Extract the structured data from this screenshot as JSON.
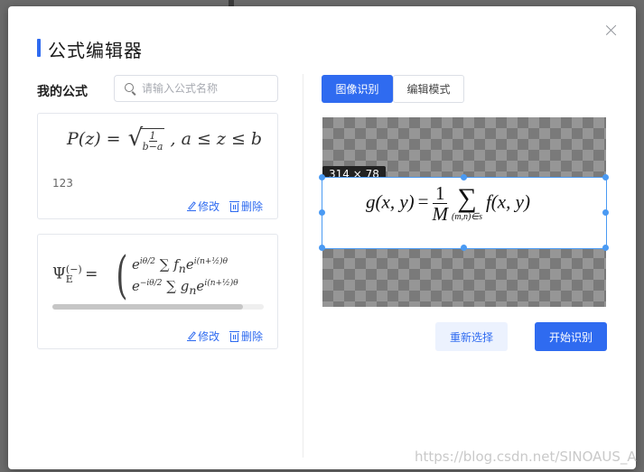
{
  "dialog": {
    "title": "公式编辑器",
    "watermark": "https://blog.csdn.net/SINOAUS_A"
  },
  "left": {
    "section_label": "我的公式",
    "search_placeholder": "请输入公式名称",
    "cards": [
      {
        "formula": {
          "lhs": "P(z) =",
          "frac_num": "1",
          "frac_den": "b−a",
          "rhs": ", a ≤ z ≤ b"
        },
        "note": "123",
        "edit_label": "修改",
        "delete_label": "删除"
      },
      {
        "formula": {
          "lhs_base": "Ψ",
          "lhs_sup": "(−)",
          "lhs_sub": "E",
          "eq": "=",
          "row1": "e",
          "row1_sup": "iθ/2",
          "row1_rest": " ∑ f",
          "row1_sub": "n",
          "row1_tail": "e",
          "row1_tail_sup": "i(n+½)θ",
          "row2": "e",
          "row2_sup": "−iθ/2",
          "row2_rest": " ∑ g",
          "row2_sub": "n",
          "row2_tail": "e",
          "row2_tail_sup": "i(n+½)θ"
        },
        "scroll_fraction": 0.9,
        "edit_label": "修改",
        "delete_label": "删除"
      }
    ]
  },
  "right": {
    "tabs": [
      {
        "label": "图像识别",
        "active": true
      },
      {
        "label": "编辑模式",
        "active": false
      }
    ],
    "crop_size_label": "314 × 78",
    "crop_formula": {
      "lhs": "g(x, y)",
      "eq": "=",
      "num": "1",
      "den": "M",
      "sum": "∑",
      "sum_limit": "(m,n)∈s",
      "rhs": "f(x, y)"
    },
    "reset_label": "重新选择",
    "start_label": "开始识别"
  },
  "colors": {
    "accent": "#2f6bf0",
    "selection": "#4a9af3"
  }
}
